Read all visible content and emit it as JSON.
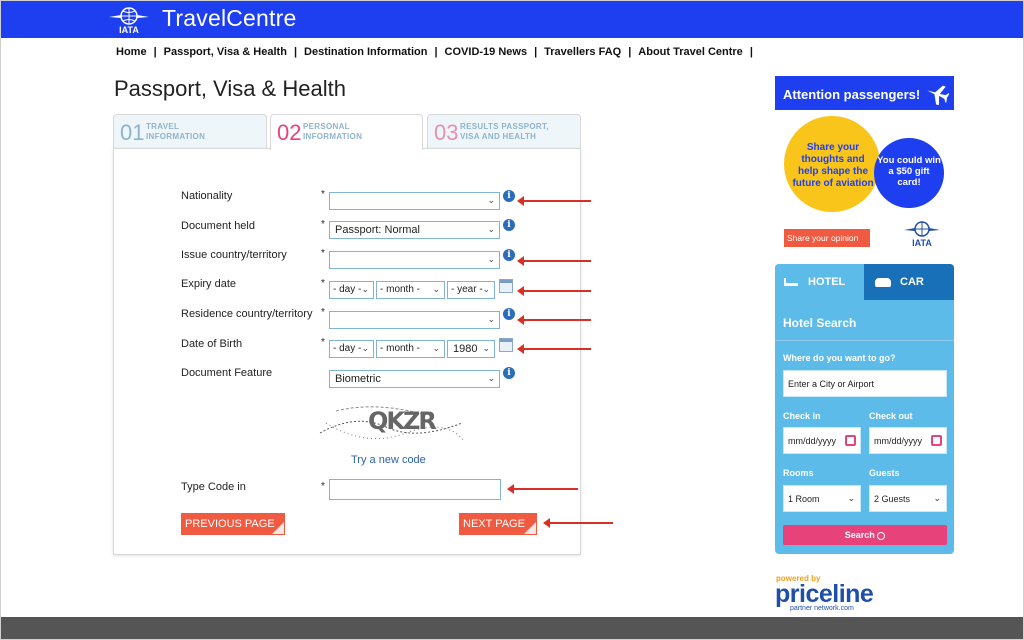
{
  "header": {
    "site_title": "TravelCentre",
    "logo_text": "IATA"
  },
  "nav": {
    "items": [
      "Home",
      "Passport, Visa & Health",
      "Destination Information",
      "COVID-19 News",
      "Travellers FAQ",
      "About Travel Centre"
    ],
    "separator": "|"
  },
  "page_title": "Passport, Visa & Health",
  "steps": [
    {
      "num": "01",
      "label_line1": "TRAVEL",
      "label_line2": "INFORMATION"
    },
    {
      "num": "02",
      "label_line1": "PERSONAL",
      "label_line2": "INFORMATION"
    },
    {
      "num": "03",
      "label_line1": "RESULTS PASSPORT,",
      "label_line2": "VISA AND HEALTH"
    }
  ],
  "form": {
    "required_mark": "*",
    "info_glyph": "i",
    "nationality": {
      "label": "Nationality",
      "value": ""
    },
    "document_held": {
      "label": "Document held",
      "value": "Passport: Normal"
    },
    "issue_country": {
      "label": "Issue country/territory",
      "value": ""
    },
    "expiry_date": {
      "label": "Expiry date",
      "day": "- day -",
      "month": "- month -",
      "year": "- year -"
    },
    "residence_country": {
      "label": "Residence country/territory",
      "value": ""
    },
    "date_of_birth": {
      "label": "Date of Birth",
      "day": "- day -",
      "month": "- month -",
      "year": "1980"
    },
    "document_feature": {
      "label": "Document Feature",
      "value": "Biometric"
    },
    "captcha_text": "QKZR",
    "new_code_link": "Try a new code",
    "type_code": {
      "label": "Type Code in",
      "value": ""
    },
    "prev_button": "PREVIOUS PAGE",
    "next_button": "NEXT PAGE"
  },
  "sidebar": {
    "attention": "Attention passengers!",
    "bubble_yellow": "Share your thoughts and help shape the future of aviation",
    "bubble_blue": "You could win a $50 gift card!",
    "share_button": "Share your opinion",
    "iata_text": "IATA"
  },
  "hotel_widget": {
    "tab_hotel": "HOTEL",
    "tab_car": "CAR",
    "title": "Hotel Search",
    "where_label": "Where do you want to go?",
    "where_placeholder": "Enter a City or Airport",
    "checkin_label": "Check in",
    "checkout_label": "Check out",
    "checkin_value": "mm/dd/yyyy",
    "checkout_value": "mm/dd/yyyy",
    "rooms_label": "Rooms",
    "guests_label": "Guests",
    "rooms_value": "1 Room",
    "guests_value": "2 Guests",
    "search_button": "Search"
  },
  "footer_brand": {
    "powered_by": "powered by",
    "name": "priceline",
    "tagline": "partner network.com"
  },
  "colors": {
    "brand_blue": "#1e3ff0",
    "accent_red": "#f05a41",
    "pink": "#e8427a",
    "widget_blue": "#5dbbea",
    "annotation_red": "#d93025"
  }
}
